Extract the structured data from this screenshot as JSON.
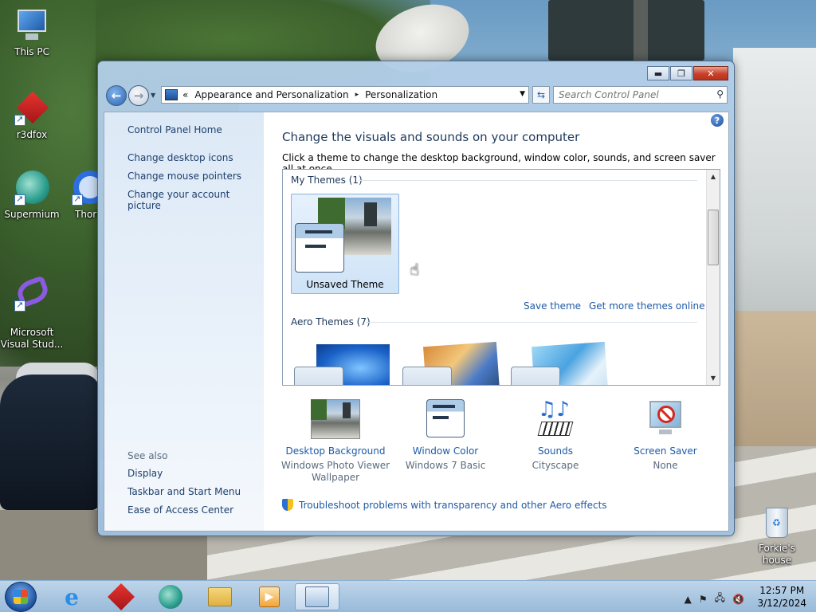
{
  "desktop": {
    "icons": [
      {
        "label": "This PC"
      },
      {
        "label": "r3dfox"
      },
      {
        "label": "Supermium"
      },
      {
        "label": "Thori"
      },
      {
        "label": "Microsoft\nVisual Stud..."
      },
      {
        "label": "Forkie's house"
      }
    ]
  },
  "window": {
    "controls": {
      "minimize": "▬",
      "maximize": "❐",
      "close": "✕"
    },
    "address": {
      "overflow": "«",
      "crumbs": [
        "Appearance and Personalization",
        "Personalization"
      ],
      "separator": "▸"
    },
    "search": {
      "placeholder": "Search Control Panel"
    },
    "sidebar": {
      "home": "Control Panel Home",
      "links": [
        "Change desktop icons",
        "Change mouse pointers",
        "Change your account picture"
      ],
      "see_also_title": "See also",
      "see_also": [
        "Display",
        "Taskbar and Start Menu",
        "Ease of Access Center"
      ]
    },
    "main": {
      "heading": "Change the visuals and sounds on your computer",
      "subtext": "Click a theme to change the desktop background, window color, sounds, and screen saver all at once.",
      "my_themes_title": "My Themes (1)",
      "unsaved_theme": "Unsaved Theme",
      "save_theme": "Save theme",
      "get_more": "Get more themes online",
      "aero_title": "Aero Themes (7)",
      "bottom": [
        {
          "title": "Desktop Background",
          "sub": "Windows Photo Viewer Wallpaper"
        },
        {
          "title": "Window Color",
          "sub": "Windows 7 Basic"
        },
        {
          "title": "Sounds",
          "sub": "Cityscape"
        },
        {
          "title": "Screen Saver",
          "sub": "None"
        }
      ],
      "troubleshoot": "Troubleshoot problems with transparency and other Aero effects"
    }
  },
  "taskbar": {
    "time": "12:57 PM",
    "date": "3/12/2024"
  }
}
